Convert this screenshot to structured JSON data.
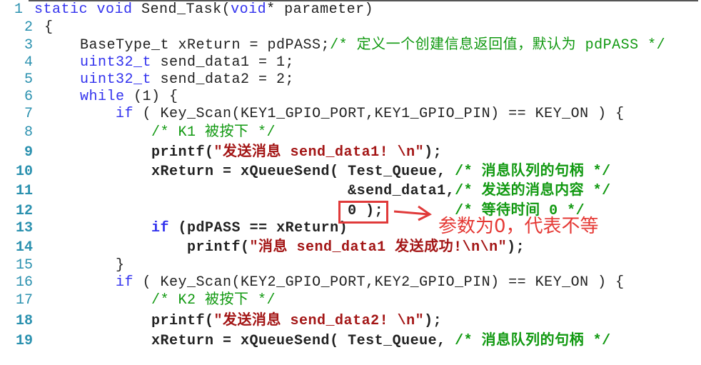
{
  "colors": {
    "keyword": "#3333ee",
    "comment": "#119911",
    "string": "#a31515",
    "line_number": "#2b91af",
    "annotation": "#e53935"
  },
  "lines": [
    {
      "num": "1",
      "bold": false,
      "tokens": [
        {
          "c": "kw",
          "t": "static"
        },
        {
          "c": "plain",
          "t": " "
        },
        {
          "c": "kw",
          "t": "void"
        },
        {
          "c": "plain",
          "t": " Send_Task("
        },
        {
          "c": "kw",
          "t": "void"
        },
        {
          "c": "plain",
          "t": "* parameter)"
        }
      ]
    },
    {
      "num": "2",
      "bold": false,
      "tokens": [
        {
          "c": "plain",
          "t": "{"
        }
      ]
    },
    {
      "num": "3",
      "bold": false,
      "tokens": [
        {
          "c": "plain",
          "t": "    BaseType_t xReturn = pdPASS;"
        },
        {
          "c": "cm",
          "t": "/* 定义一个创建信息返回值，默认为 pdPASS */"
        }
      ]
    },
    {
      "num": "4",
      "bold": false,
      "tokens": [
        {
          "c": "plain",
          "t": "    "
        },
        {
          "c": "kw",
          "t": "uint32_t"
        },
        {
          "c": "plain",
          "t": " send_data1 = 1;"
        }
      ]
    },
    {
      "num": "5",
      "bold": false,
      "tokens": [
        {
          "c": "plain",
          "t": "    "
        },
        {
          "c": "kw",
          "t": "uint32_t"
        },
        {
          "c": "plain",
          "t": " send_data2 = 2;"
        }
      ]
    },
    {
      "num": "6",
      "bold": false,
      "tokens": [
        {
          "c": "plain",
          "t": "    "
        },
        {
          "c": "kw",
          "t": "while"
        },
        {
          "c": "plain",
          "t": " (1) {"
        }
      ]
    },
    {
      "num": "7",
      "bold": false,
      "tokens": [
        {
          "c": "plain",
          "t": "        "
        },
        {
          "c": "kw",
          "t": "if"
        },
        {
          "c": "plain",
          "t": " ( Key_Scan(KEY1_GPIO_PORT,KEY1_GPIO_PIN) == KEY_ON ) {"
        }
      ]
    },
    {
      "num": "8",
      "bold": false,
      "tokens": [
        {
          "c": "plain",
          "t": "            "
        },
        {
          "c": "cm",
          "t": "/* K1 被按下 */"
        }
      ]
    },
    {
      "num": "9",
      "bold": true,
      "tokens": [
        {
          "c": "plain",
          "t": "            printf("
        },
        {
          "c": "str",
          "t": "\"发送消息 send_data1! \\n\""
        },
        {
          "c": "plain",
          "t": ");"
        }
      ]
    },
    {
      "num": "10",
      "bold": true,
      "tokens": [
        {
          "c": "plain",
          "t": "            xReturn = xQueueSend( Test_Queue, "
        },
        {
          "c": "cm",
          "t": "/* 消息队列的句柄 */"
        }
      ]
    },
    {
      "num": "11",
      "bold": true,
      "tokens": [
        {
          "c": "plain",
          "t": "                                  &send_data1,"
        },
        {
          "c": "cm",
          "t": "/* 发送的消息内容 */"
        }
      ]
    },
    {
      "num": "12",
      "bold": true,
      "tokens": [
        {
          "c": "plain",
          "t": "                                  0 );        "
        },
        {
          "c": "cm",
          "t": "/* 等待时间 0 */"
        }
      ]
    },
    {
      "num": "13",
      "bold": true,
      "tokens": [
        {
          "c": "plain",
          "t": "            "
        },
        {
          "c": "kw",
          "t": "if"
        },
        {
          "c": "plain",
          "t": " (pdPASS == xReturn)"
        }
      ]
    },
    {
      "num": "14",
      "bold": true,
      "tokens": [
        {
          "c": "plain",
          "t": "                printf("
        },
        {
          "c": "str",
          "t": "\"消息 send_data1 发送成功!\\n\\n\""
        },
        {
          "c": "plain",
          "t": ");"
        }
      ]
    },
    {
      "num": "15",
      "bold": false,
      "tokens": [
        {
          "c": "plain",
          "t": "        }"
        }
      ]
    },
    {
      "num": "16",
      "bold": false,
      "tokens": [
        {
          "c": "plain",
          "t": "        "
        },
        {
          "c": "kw",
          "t": "if"
        },
        {
          "c": "plain",
          "t": " ( Key_Scan(KEY2_GPIO_PORT,KEY2_GPIO_PIN) == KEY_ON ) {"
        }
      ]
    },
    {
      "num": "17",
      "bold": false,
      "tokens": [
        {
          "c": "plain",
          "t": "            "
        },
        {
          "c": "cm",
          "t": "/* K2 被按下 */"
        }
      ]
    },
    {
      "num": "18",
      "bold": true,
      "tokens": [
        {
          "c": "plain",
          "t": "            printf("
        },
        {
          "c": "str",
          "t": "\"发送消息 send_data2! \\n\""
        },
        {
          "c": "plain",
          "t": ");"
        }
      ]
    },
    {
      "num": "19",
      "bold": true,
      "tokens": [
        {
          "c": "plain",
          "t": "            xReturn = xQueueSend( Test_Queue, "
        },
        {
          "c": "cm",
          "t": "/* 消息队列的句柄 */"
        }
      ]
    }
  ],
  "annotation": {
    "text": "参数为0，代表不等"
  }
}
